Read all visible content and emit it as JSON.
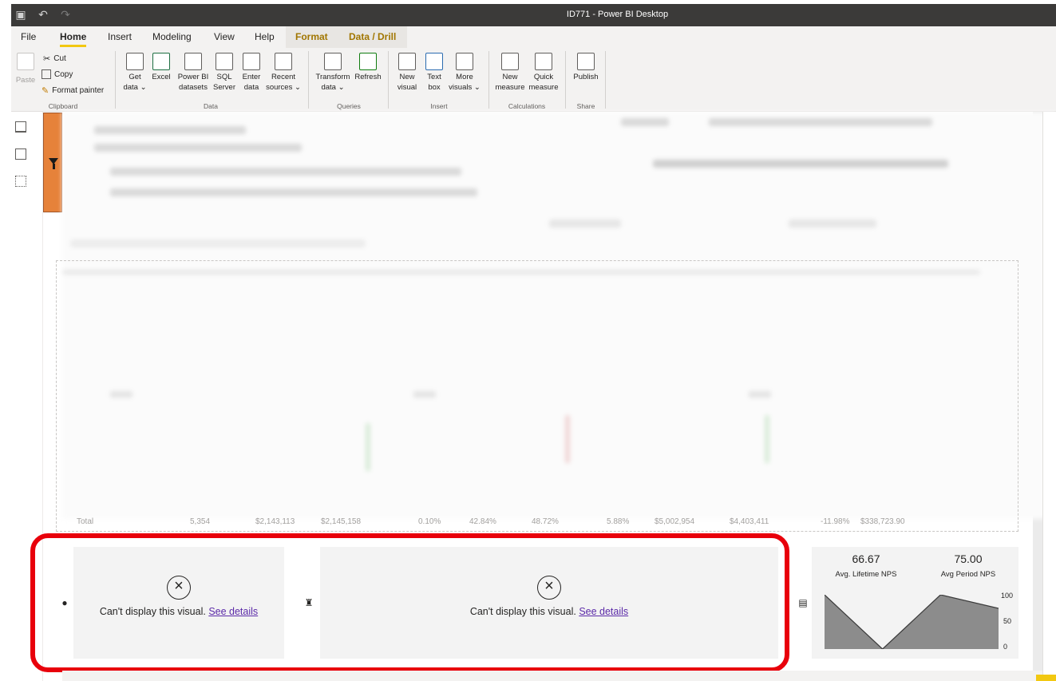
{
  "window": {
    "title": "ID771 - Power BI Desktop"
  },
  "menu": {
    "tabs": [
      "File",
      "Home",
      "Insert",
      "Modeling",
      "View",
      "Help",
      "Format",
      "Data / Drill"
    ]
  },
  "ribbon": {
    "clipboard": {
      "paste": "Paste",
      "cut": "Cut",
      "copy": "Copy",
      "format_painter": "Format painter",
      "label": "Clipboard"
    },
    "data": {
      "get_data": [
        "Get",
        "data ⌄"
      ],
      "excel": [
        "Excel",
        ""
      ],
      "pbi_datasets": [
        "Power BI",
        "datasets"
      ],
      "sql": [
        "SQL",
        "Server"
      ],
      "enter": [
        "Enter",
        "data"
      ],
      "recent": [
        "Recent",
        "sources ⌄"
      ],
      "label": "Data"
    },
    "queries": {
      "transform": [
        "Transform",
        "data ⌄"
      ],
      "refresh": [
        "Refresh",
        ""
      ],
      "label": "Queries"
    },
    "insert": {
      "new_visual": [
        "New",
        "visual"
      ],
      "text_box": [
        "Text",
        "box"
      ],
      "more_visuals": [
        "More",
        "visuals ⌄"
      ],
      "label": "Insert"
    },
    "calculations": {
      "new_measure": [
        "New",
        "measure"
      ],
      "quick_measure": [
        "Quick",
        "measure"
      ],
      "label": "Calculations"
    },
    "share": {
      "publish": [
        "Publish",
        ""
      ],
      "label": "Share"
    }
  },
  "table": {
    "total_row": [
      "Total",
      "5,354",
      "$2,143,113",
      "$2,145,158",
      "0.10%",
      "42.84%",
      "48.72%",
      "5.88%",
      "$5,002,954",
      "$4,403,411",
      "-11.98%",
      "$338,723.90"
    ]
  },
  "visual_errors": {
    "message": "Can't display this visual.",
    "link": "See details"
  },
  "nps": {
    "lifetime_value": "66.67",
    "lifetime_label": "Avg. Lifetime NPS",
    "period_value": "75.00",
    "period_label": "Avg Period NPS",
    "axis_ticks": [
      "100",
      "50",
      "0"
    ],
    "chart_values": [
      100,
      0,
      100,
      75
    ]
  },
  "colors": {
    "accent": "#f2c811",
    "highlight": "#e8000b",
    "filter_pane": "#e6823a",
    "link": "#5b2aa8"
  }
}
